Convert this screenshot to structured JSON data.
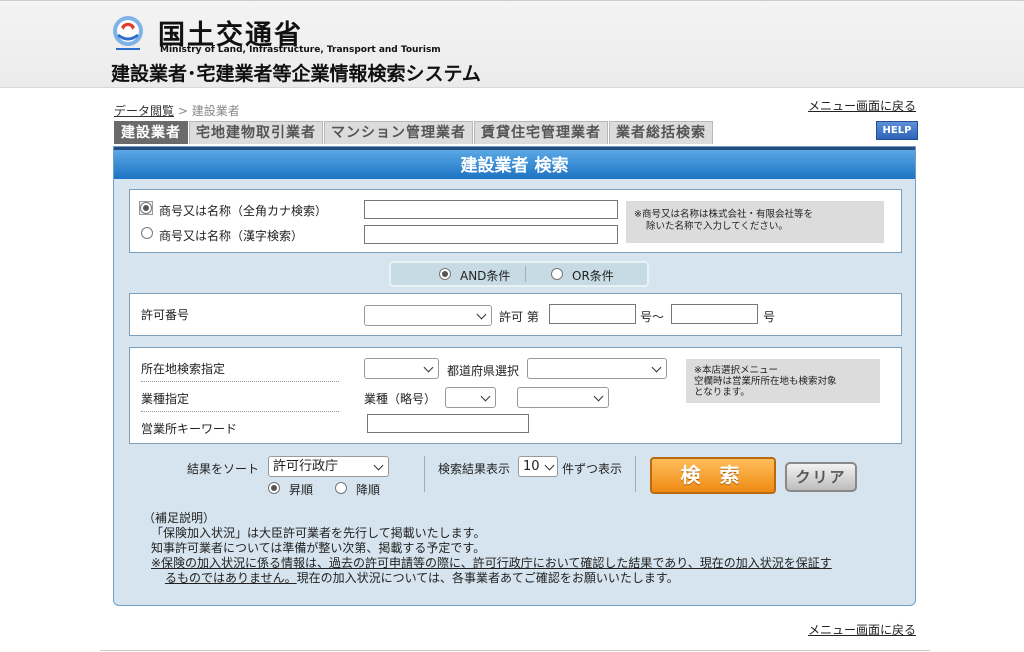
{
  "header": {
    "ministry_jp": "国土交通省",
    "ministry_en": "Ministry of Land, Infrastructure, Transport and Tourism",
    "system_title": "建設業者･宅建業者等企業情報検索システム"
  },
  "breadcrumb": {
    "root": "データ閲覧",
    "separator": ">",
    "current": "建設業者"
  },
  "menu_link": "メニュー画面に戻る",
  "tabs": [
    {
      "label": "建設業者",
      "active": true
    },
    {
      "label": "宅地建物取引業者",
      "active": false
    },
    {
      "label": "マンション管理業者",
      "active": false
    },
    {
      "label": "賃貸住宅管理業者",
      "active": false
    },
    {
      "label": "業者総括検索",
      "active": false
    }
  ],
  "help_label": "HELP",
  "panel_title": "建設業者 検索",
  "name_search": {
    "option_kana": "商号又は名称（全角カナ検索）",
    "option_kanji": "商号又は名称（漢字検索）",
    "kana_value": "",
    "kanji_value": "",
    "note_line1": "※商号又は名称は株式会社・有限会社等を",
    "note_line2": "除いた名称で入力してください。"
  },
  "condition": {
    "and_label": "AND条件",
    "or_label": "OR条件"
  },
  "license": {
    "label": "許可番号",
    "select_value": "",
    "prefix": "許可 第",
    "from_value": "",
    "middle": "号～",
    "to_value": "",
    "suffix": "号"
  },
  "location": {
    "label": "所在地検索指定",
    "select_value": "",
    "pref_label": "都道府県選択",
    "pref_value": "",
    "industry_label": "業種指定",
    "industry_sub": "業種（略号）",
    "industry_value1": "",
    "industry_value2": "",
    "keyword_label": "営業所キーワード",
    "keyword_value": "",
    "note_line1": "※本店選択メニュー",
    "note_line2": "空欄時は営業所所在地も検索対象",
    "note_line3": "となります。"
  },
  "sort": {
    "label": "結果をソート",
    "value": "許可行政庁",
    "asc": "昇順",
    "desc": "降順",
    "display_label": "検索結果表示",
    "display_value": "10",
    "display_suffix": "件ずつ表示"
  },
  "buttons": {
    "search": "検 索",
    "clear": "クリア"
  },
  "notes": {
    "title": "（補足説明）",
    "line1": "「保険加入状況」は大臣許可業者を先行して掲載いたします。",
    "line2": "知事許可業者については準備が整い次第、掲載する予定です。",
    "line3_underlined": "※保険の加入状況に係る情報は、過去の許可申請等の際に、許可行政庁において確認した結果であり、現在の加入状況を保証す",
    "line4_underlined": "るものではありません。",
    "line4_rest": "現在の加入状況については、各事業者あてご確認をお願いいたします。"
  },
  "colors": {
    "title_bar": "#1d73c2",
    "panel_bg": "#d5e4ee",
    "search_button": "#ef8a14",
    "active_tab": "#6a6a6a"
  }
}
